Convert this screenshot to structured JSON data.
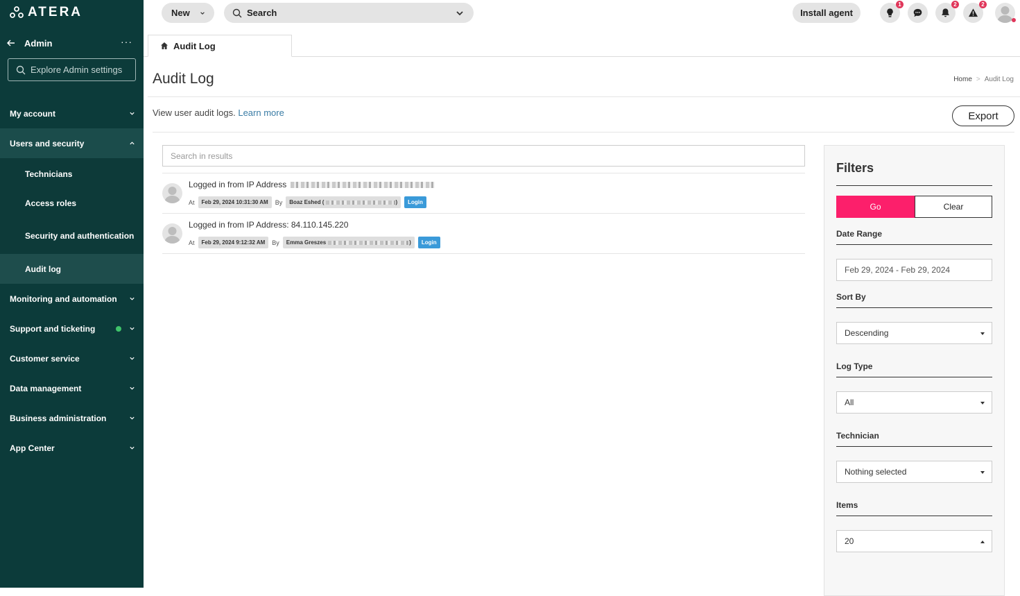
{
  "app": {
    "logo_text": "ATERA"
  },
  "sidebar": {
    "back_title": "Admin",
    "more_label": "···",
    "search_placeholder": "Explore Admin settings",
    "sections": [
      {
        "label": "My account"
      },
      {
        "label": "Users and security",
        "sub_items": [
          "Technicians",
          "Access roles",
          "Security and authentication",
          "Audit log"
        ],
        "active_sub": "Audit log"
      },
      {
        "label": "Monitoring and automation"
      },
      {
        "label": "Support and ticketing",
        "status": "green"
      },
      {
        "label": "Customer service"
      },
      {
        "label": "Data management"
      },
      {
        "label": "Business administration"
      },
      {
        "label": "App Center"
      }
    ]
  },
  "topbar": {
    "new_label": "New",
    "search_label": "Search",
    "install_label": "Install agent",
    "badges": {
      "tips": "1",
      "notifications": "2",
      "alerts": "2"
    }
  },
  "tab": {
    "label": "Audit Log"
  },
  "page": {
    "title": "Audit Log",
    "breadcrumb_home": "Home",
    "breadcrumb_current": "Audit Log",
    "description": "View user audit logs.",
    "learn_more": "Learn more",
    "export_label": "Export"
  },
  "results": {
    "search_placeholder": "Search in results",
    "entries": [
      {
        "message": "Logged in from IP Address",
        "at_label": "At",
        "timestamp": "Feb 29, 2024 10:31:30 AM",
        "by_label": "By",
        "user": "Boaz Eshed (",
        "user_suffix": ")",
        "type": "Login"
      },
      {
        "message": "Logged in from IP Address: 84.110.145.220",
        "at_label": "At",
        "timestamp": "Feb 29, 2024 9:12:32 AM",
        "by_label": "By",
        "user": "Emma Greszes",
        "user_suffix": ")",
        "type": "Login"
      }
    ]
  },
  "filters": {
    "title": "Filters",
    "go_label": "Go",
    "clear_label": "Clear",
    "date_range_label": "Date Range",
    "date_range_value": "Feb 29, 2024 - Feb 29, 2024",
    "sort_by_label": "Sort By",
    "sort_by_value": "Descending",
    "log_type_label": "Log Type",
    "log_type_value": "All",
    "technician_label": "Technician",
    "technician_value": "Nothing selected",
    "items_label": "Items",
    "items_value": "20"
  },
  "colors": {
    "sidebar_bg": "#0c3b3a",
    "go_button": "#fc1f6b",
    "login_tag": "#3a9ad9",
    "link": "#3a7ca5",
    "badge": "#e0365a"
  }
}
